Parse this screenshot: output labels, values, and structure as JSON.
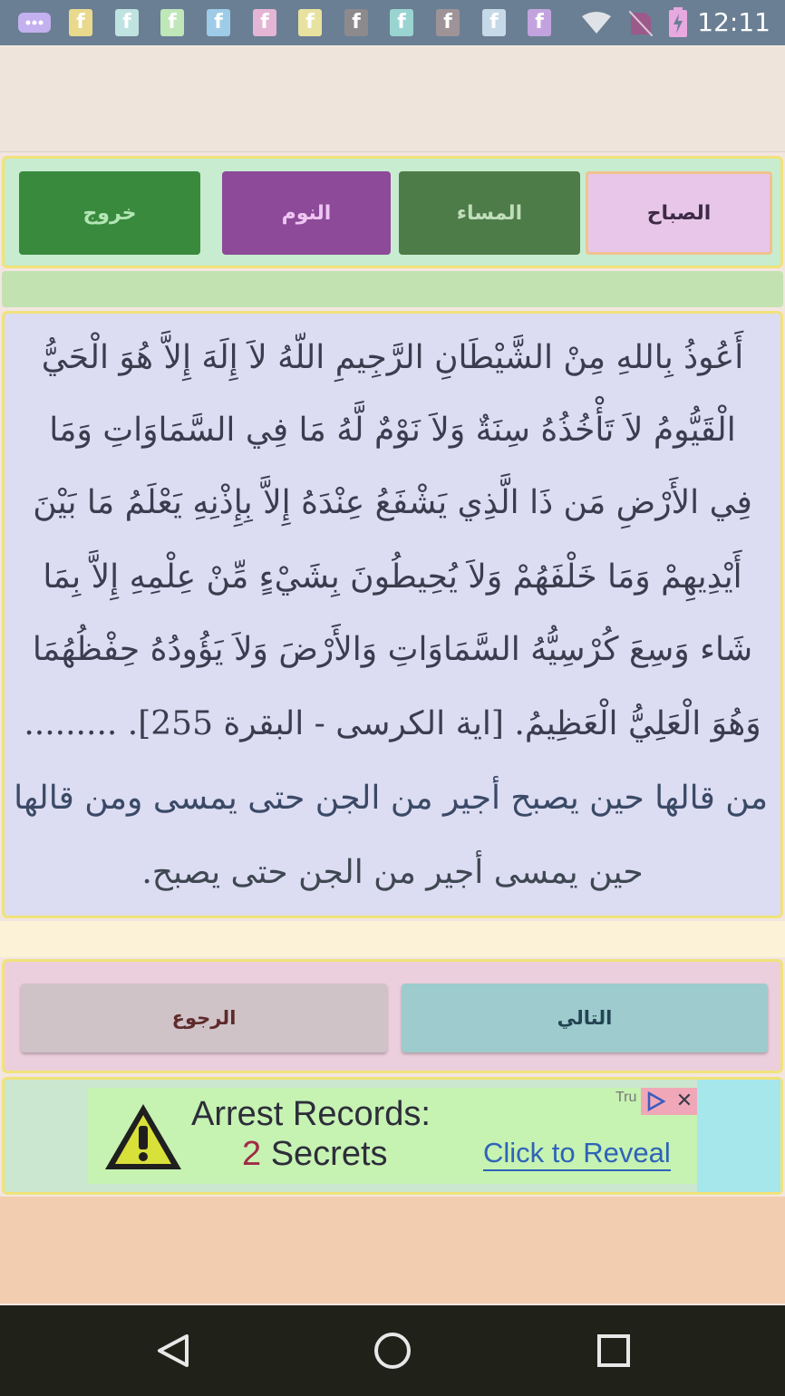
{
  "status_bar": {
    "time": "12:11",
    "notification_icons": [
      "f",
      "f",
      "f",
      "f",
      "f",
      "f",
      "f",
      "f",
      "f",
      "f",
      "f"
    ],
    "notification_colors": [
      "#e8d98c",
      "#bfe3e0",
      "#bfe7b8",
      "#9ecbe8",
      "#e5b5d5",
      "#e8e2a0",
      "#8d8a8e",
      "#99d4d0",
      "#9e9498",
      "#c6d9e8",
      "#c3a3de"
    ]
  },
  "tabs": {
    "morning": "الصباح",
    "evening": "المساء",
    "sleep": "النوم",
    "exit": "خروج"
  },
  "verse": {
    "line1": "أَعُوذُ بِاللهِ مِنْ الشَّيْطَانِ الرَّجِيمِ اللّهُ لاَ إِلَهَ إِلاَّ هُوَ الْحَيُّ",
    "line2": "الْقَيُّومُ لاَ تَأْخُذُهُ سِنَةٌ وَلاَ نَوْمٌ لَّهُ مَا فِي السَّمَاوَاتِ وَمَا",
    "line3": "فِي الأَرْضِ مَن ذَا الَّذِي يَشْفَعُ عِنْدَهُ إِلاَّ بِإِذْنِهِ يَعْلَمُ مَا بَيْنَ",
    "line4": "أَيْدِيهِمْ وَمَا خَلْفَهُمْ وَلاَ يُحِيطُونَ بِشَيْءٍ مِّنْ عِلْمِهِ إِلاَّ بِمَا",
    "line5": "شَاء وَسِعَ كُرْسِيُّهُ السَّمَاوَاتِ وَالأَرْضَ وَلاَ يَؤُودُهُ حِفْظُهُمَا",
    "line6_text": "وَهُوَ الْعَلِيُّ الْعَظِيمُ. [اية الكرسى - البقرة 255]. .........",
    "line7": "من قالها حين يصبح أجير من الجن حتى يمسى ومن قالها",
    "line8": "حين يمسى أجير من الجن حتى يصبح."
  },
  "nav": {
    "next": "التالي",
    "back": "الرجوع"
  },
  "ad": {
    "title": "Arrest Records:",
    "sub_number": "2",
    "sub_text": "Secrets",
    "cta": "Click to Reveal",
    "tru": "Tru",
    "close": "✕"
  },
  "colors": {
    "exit_tab": "#3a8a3e",
    "sleep_tab": "#8c4a98",
    "evening_tab": "#4d7c48",
    "morning_tab": "#e8c6ea",
    "verse_bg": "#dcdcf2",
    "border_accent": "#f1e27a"
  }
}
